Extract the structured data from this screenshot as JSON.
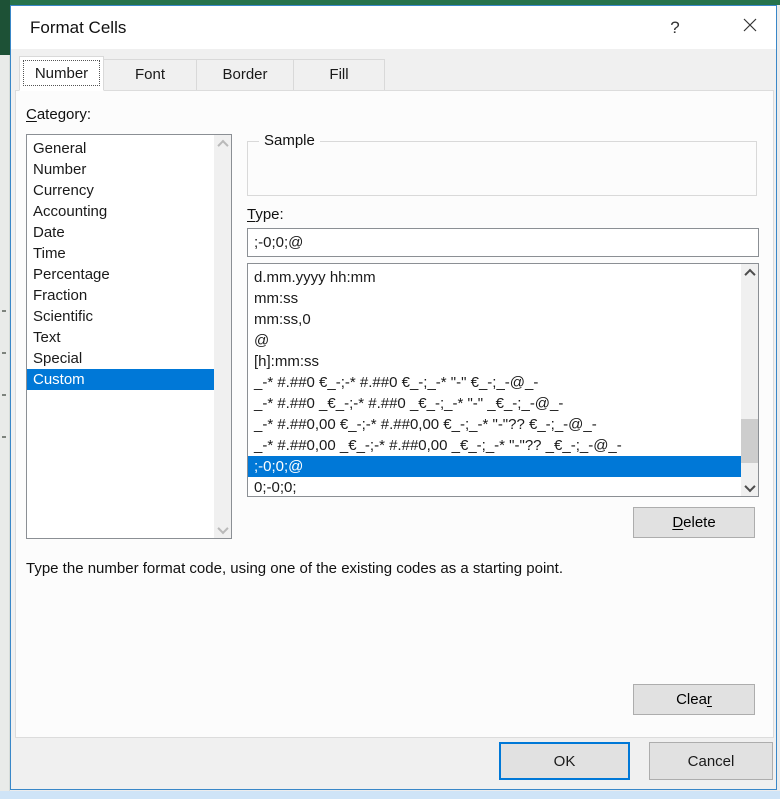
{
  "colors": {
    "selection": "#0078d7",
    "excel_green": "#217346",
    "default_button_border": "#0078d7",
    "dialog_border": "#3987c8"
  },
  "window": {
    "title": "Format Cells",
    "help_glyph": "?"
  },
  "tabs": {
    "active_index": 0,
    "items": [
      {
        "label": "Number"
      },
      {
        "label": "Font"
      },
      {
        "label": "Border"
      },
      {
        "label": "Fill"
      }
    ]
  },
  "category": {
    "label": {
      "pre": "",
      "u": "C",
      "post": "ategory:"
    },
    "selected_index": 11,
    "selected": "Custom",
    "items": [
      "General",
      "Number",
      "Currency",
      "Accounting",
      "Date",
      "Time",
      "Percentage",
      "Fraction",
      "Scientific",
      "Text",
      "Special",
      "Custom"
    ]
  },
  "sample": {
    "label": "Sample",
    "value": ""
  },
  "type_field": {
    "label": {
      "pre": "",
      "u": "T",
      "post": "ype:"
    },
    "value": ";-0;0;@"
  },
  "format_list": {
    "selected_index": 9,
    "items": [
      "d.mm.yyyy hh:mm",
      "mm:ss",
      "mm:ss,0",
      "@",
      "[h]:mm:ss",
      "_-* #.##0 €_-;-* #.##0 €_-;_-* \"-\" €_-;_-@_-",
      "_-* #.##0 _€_-;-* #.##0 _€_-;_-* \"-\" _€_-;_-@_-",
      "_-* #.##0,00 €_-;-* #.##0,00 €_-;_-* \"-\"?? €_-;_-@_-",
      "_-* #.##0,00 _€_-;-* #.##0,00 _€_-;_-* \"-\"?? _€_-;_-@_-",
      ";-0;0;@",
      "0;-0;0;"
    ]
  },
  "help_text": "Type the number format code, using one of the existing codes as a starting point.",
  "buttons": {
    "delete": {
      "pre": "",
      "u": "D",
      "post": "elete"
    },
    "clear": {
      "pre": "Clea",
      "u": "r",
      "post": ""
    },
    "ok": "OK",
    "cancel": "Cancel"
  }
}
